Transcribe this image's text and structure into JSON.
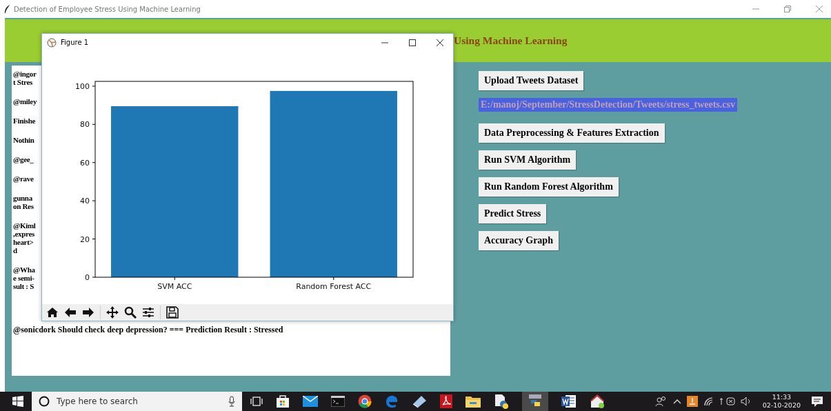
{
  "window": {
    "title": "Detection of Employee Stress Using Machine Learning"
  },
  "header": {
    "title": "Using Machine Learning"
  },
  "output_lines": [
    {
      "lines": [
        "@ingor",
        "t Stres"
      ]
    },
    {
      "lines": [
        "@miley"
      ]
    },
    {
      "lines": [
        "Finishe"
      ]
    },
    {
      "lines": [
        "Nothin"
      ]
    },
    {
      "lines": [
        "@gee_"
      ]
    },
    {
      "lines": [
        "@rave"
      ]
    },
    {
      "lines": [
        "gunna",
        "on Res"
      ]
    },
    {
      "lines": [
        "@Kiml",
        ",expres",
        "heart>",
        "d"
      ]
    },
    {
      "lines": [
        "@Wha",
        "e semi-",
        "sult : S"
      ]
    }
  ],
  "last_result": "@sonicdork Should check deep depression? === Prediction Result : Stressed",
  "actions": [
    {
      "kind": "button",
      "label": "Upload Tweets Dataset"
    },
    {
      "kind": "path",
      "label": "E:/manoj/September/StressDetection/Tweets/stress_tweets.csv"
    },
    {
      "kind": "button",
      "label": "Data Preprocessing & Features Extraction"
    },
    {
      "kind": "button",
      "label": "Run SVM Algorithm"
    },
    {
      "kind": "button",
      "label": "Run Random Forest Algorithm"
    },
    {
      "kind": "button",
      "label": "Predict Stress"
    },
    {
      "kind": "button",
      "label": "Accuracy Graph"
    }
  ],
  "figure": {
    "title": "Figure 1",
    "chart_data": {
      "type": "bar",
      "categories": [
        "SVM ACC",
        "Random Forest ACC"
      ],
      "values": [
        89.5,
        97.5
      ],
      "ylim": [
        0,
        102.5
      ],
      "yticks": [
        0,
        20,
        40,
        60,
        80,
        100
      ]
    }
  },
  "taskbar": {
    "search": {
      "placeholder": "Type here to search"
    },
    "time": "11:33",
    "date": "02-10-2020"
  }
}
